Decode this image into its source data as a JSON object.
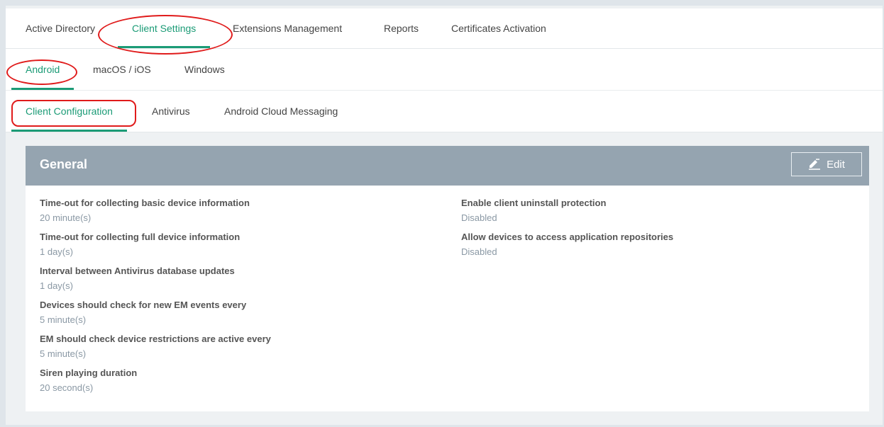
{
  "top_tabs": [
    {
      "label": "Active Directory"
    },
    {
      "label": "Client Settings"
    },
    {
      "label": "Extensions Management"
    },
    {
      "label": "Reports"
    },
    {
      "label": "Certificates Activation"
    }
  ],
  "os_tabs": [
    {
      "label": "Android"
    },
    {
      "label": "macOS / iOS"
    },
    {
      "label": "Windows"
    }
  ],
  "config_tabs": [
    {
      "label": "Client Configuration"
    },
    {
      "label": "Antivirus"
    },
    {
      "label": "Android Cloud Messaging"
    }
  ],
  "panel": {
    "title": "General",
    "edit_label": "Edit",
    "left_fields": [
      {
        "label": "Time-out for collecting basic device information",
        "value": "20 minute(s)"
      },
      {
        "label": "Time-out for collecting full device information",
        "value": "1 day(s)"
      },
      {
        "label": "Interval between Antivirus database updates",
        "value": "1 day(s)"
      },
      {
        "label": "Devices should check for new EM events every",
        "value": "5 minute(s)"
      },
      {
        "label": "EM should check device restrictions are active every",
        "value": "5 minute(s)"
      },
      {
        "label": "Siren playing duration",
        "value": "20 second(s)"
      }
    ],
    "right_fields": [
      {
        "label": "Enable client uninstall protection",
        "value": "Disabled"
      },
      {
        "label": "Allow devices to access application repositories",
        "value": "Disabled"
      }
    ]
  },
  "colors": {
    "accent": "#1b9b76",
    "highlight_ring": "#e01b1b",
    "panel_header": "#95a4b0",
    "value_text": "#8a98a4"
  }
}
